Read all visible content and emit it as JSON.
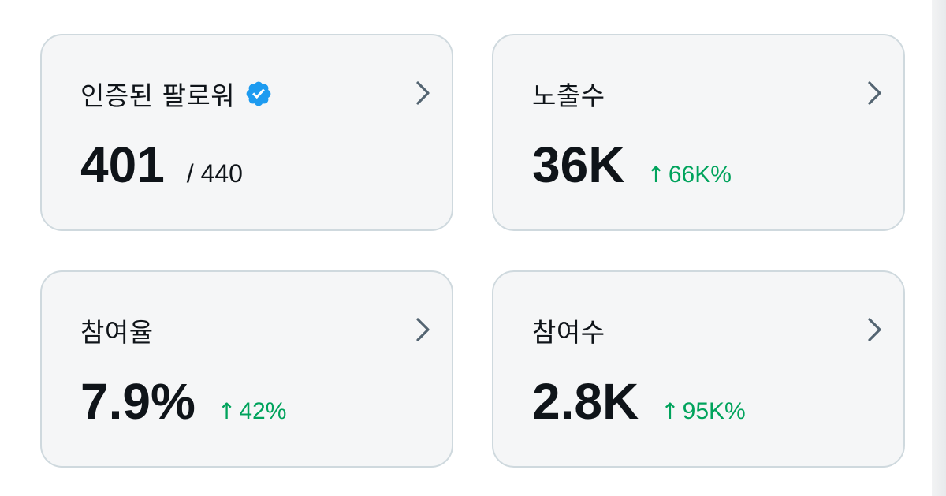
{
  "colors": {
    "card_background": "#f5f6f7",
    "card_border": "#cfd9de",
    "text_primary": "#0f1419",
    "chevron": "#536471",
    "positive_change": "#00a35c",
    "verified_badge": "#1d9bf0"
  },
  "cards": [
    {
      "title": "인증된 팔로워",
      "title_icon": "verified-badge-icon",
      "value": "401",
      "total": "/ 440",
      "nav_icon": "chevron-right-icon"
    },
    {
      "title": "노출수",
      "value": "36K",
      "change_arrow": "↑",
      "change": "66K%",
      "nav_icon": "chevron-right-icon"
    },
    {
      "title": "참여율",
      "value": "7.9%",
      "change_arrow": "↑",
      "change": "42%",
      "nav_icon": "chevron-right-icon"
    },
    {
      "title": "참여수",
      "value": "2.8K",
      "change_arrow": "↑",
      "change": "95K%",
      "nav_icon": "chevron-right-icon"
    }
  ]
}
